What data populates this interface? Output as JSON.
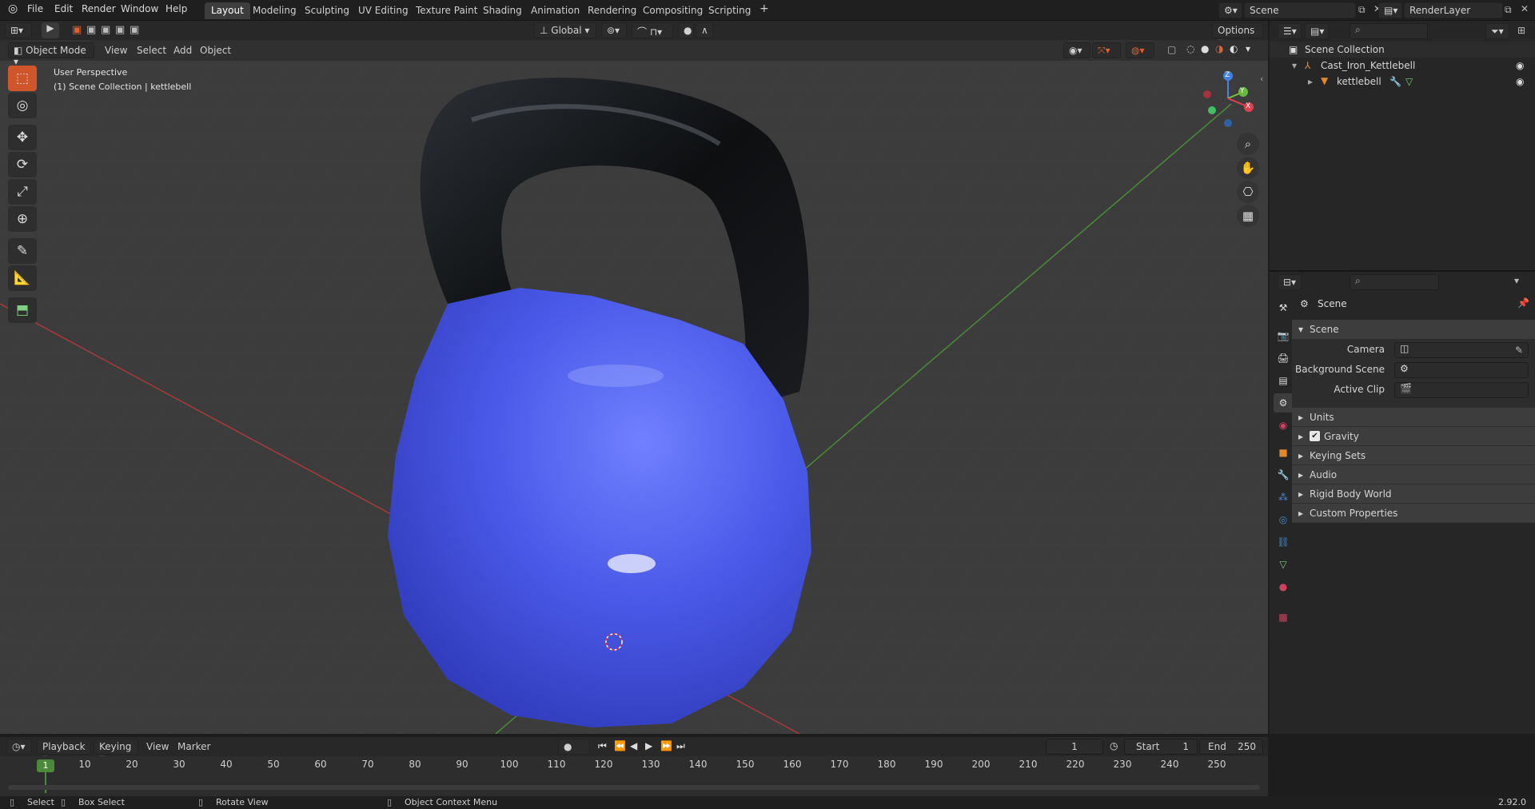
{
  "topbar": {
    "menus": [
      "File",
      "Edit",
      "Render",
      "Window",
      "Help"
    ],
    "workspaces": [
      "Layout",
      "Modeling",
      "Sculpting",
      "UV Editing",
      "Texture Paint",
      "Shading",
      "Animation",
      "Rendering",
      "Compositing",
      "Scripting"
    ],
    "active_workspace": "Layout",
    "add_tab": "+",
    "scene_name": "Scene",
    "view_layer": "RenderLayer"
  },
  "viewport_header": {
    "mode": "Object Mode",
    "menus": [
      "View",
      "Select",
      "Add",
      "Object"
    ],
    "orientation": "Global",
    "options_label": "Options"
  },
  "viewport": {
    "perspective_label": "User Perspective",
    "collection_label": "(1) Scene Collection | kettlebell",
    "object_color": "#4a5ae8",
    "handle_color": "#101214",
    "gizmo_axes": {
      "x": "X",
      "y": "Y",
      "z": "Z"
    }
  },
  "toolbar": {
    "tools": [
      "select-box-icon",
      "cursor-icon",
      "move-icon",
      "rotate-icon",
      "scale-icon",
      "transform-icon",
      "annotate-icon",
      "measure-icon",
      "add-cube-icon"
    ]
  },
  "outliner": {
    "search_placeholder": "",
    "items": [
      {
        "label": "Scene Collection",
        "icon": "collection-icon"
      },
      {
        "label": "Cast_Iron_Kettlebell",
        "icon": "empty-icon"
      },
      {
        "label": "kettlebell",
        "icon": "mesh-icon"
      }
    ]
  },
  "properties": {
    "context": "Scene",
    "panel_title": "Scene",
    "fields": [
      {
        "label": "Camera",
        "value": ""
      },
      {
        "label": "Background Scene",
        "value": ""
      },
      {
        "label": "Active Clip",
        "value": ""
      }
    ],
    "subpanels": [
      "Units",
      "Gravity",
      "Keying Sets",
      "Audio",
      "Rigid Body World",
      "Custom Properties"
    ],
    "gravity_checked": true
  },
  "timeline": {
    "menus": [
      "Playback",
      "Keying",
      "View",
      "Marker"
    ],
    "current_frame": "1",
    "start_label": "Start",
    "start_value": "1",
    "end_label": "End",
    "end_value": "250",
    "ticks": [
      "10",
      "20",
      "30",
      "40",
      "50",
      "60",
      "70",
      "80",
      "90",
      "100",
      "110",
      "120",
      "130",
      "140",
      "150",
      "160",
      "170",
      "180",
      "190",
      "200",
      "210",
      "220",
      "230",
      "240",
      "250"
    ],
    "current_badge": "1"
  },
  "statusbar": {
    "select": "Select",
    "box_select": "Box Select",
    "rotate_view": "Rotate View",
    "context_menu": "Object Context Menu",
    "version": "2.92.0"
  }
}
